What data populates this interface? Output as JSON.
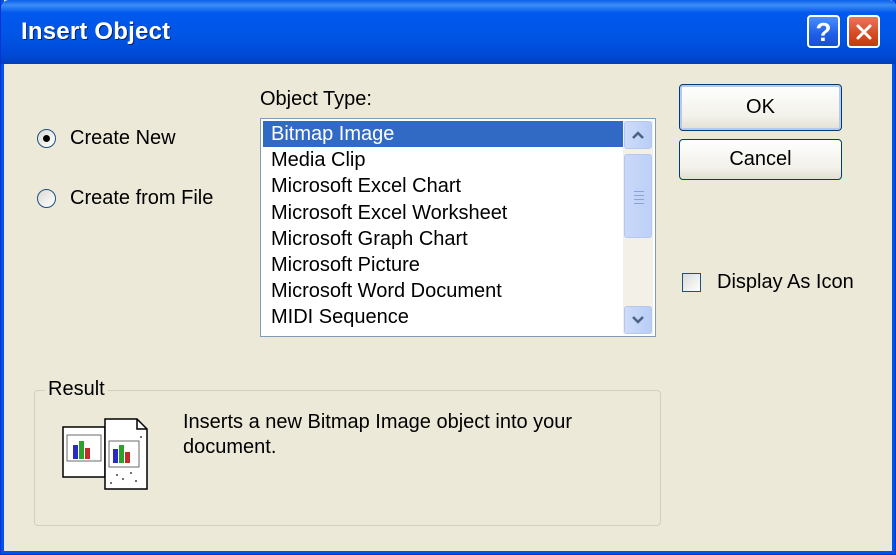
{
  "window": {
    "title": "Insert Object",
    "help_label": "?",
    "close_label": "×"
  },
  "options": {
    "create_new_label": "Create New",
    "create_from_file_label": "Create from File",
    "selected": "Create New"
  },
  "object_type": {
    "label": "Object Type:",
    "items": [
      "Bitmap Image",
      "Media Clip",
      "Microsoft Excel Chart",
      "Microsoft Excel Worksheet",
      "Microsoft Graph Chart",
      "Microsoft Picture",
      "Microsoft Word Document",
      "MIDI Sequence"
    ],
    "selected_item": "Bitmap Image"
  },
  "buttons": {
    "ok_label": "OK",
    "cancel_label": "Cancel"
  },
  "display_as_icon": {
    "label": "Display As Icon",
    "checked": false
  },
  "result": {
    "label": "Result",
    "text": "Inserts a new Bitmap Image object into your document."
  },
  "colors": {
    "selection": "#316ac5",
    "title_bar": "#0055e5",
    "face": "#ece9d8"
  }
}
